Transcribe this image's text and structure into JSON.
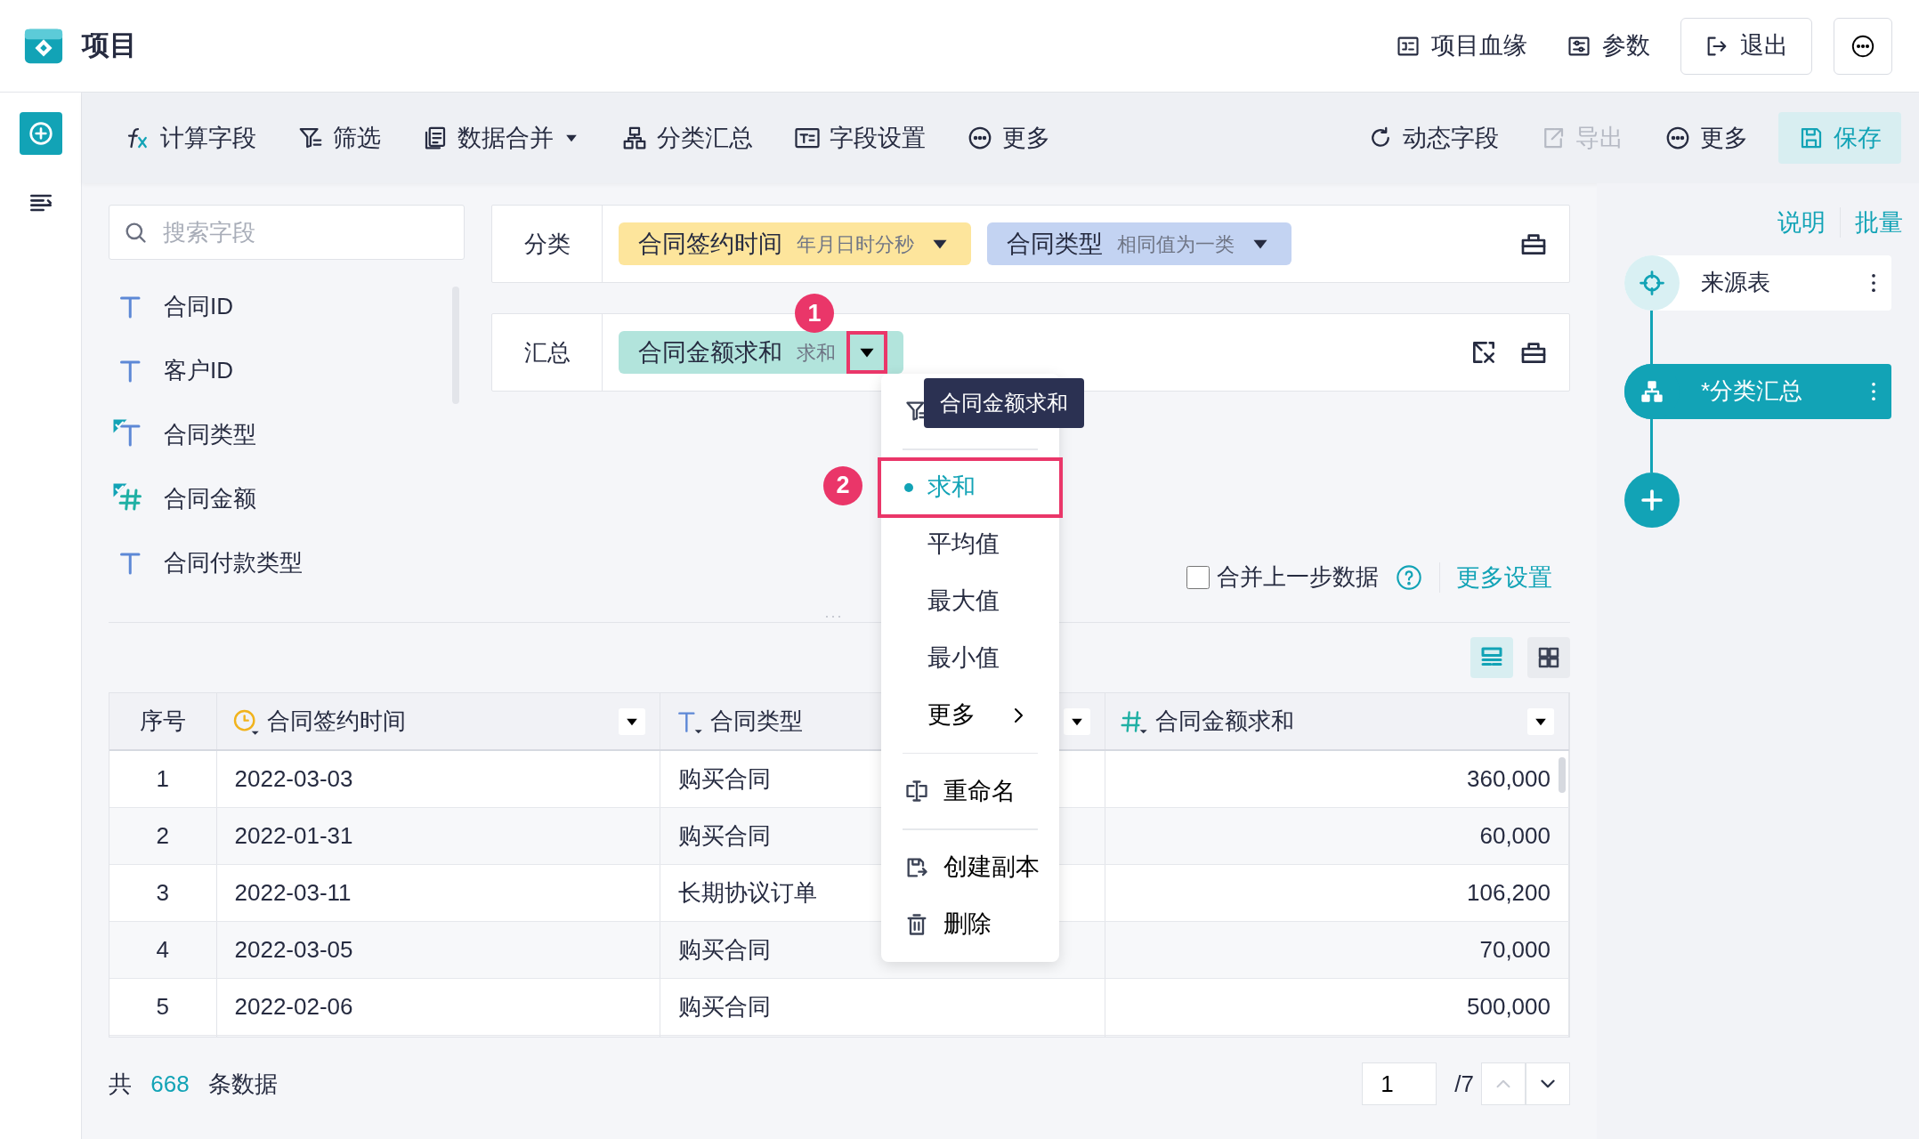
{
  "app": {
    "title": "项目"
  },
  "header_actions": [
    {
      "label": "项目血缘",
      "kind": "plain"
    },
    {
      "label": "参数",
      "kind": "plain"
    },
    {
      "label": "退出",
      "kind": "outlined"
    }
  ],
  "toolbar_left": [
    {
      "label": "计算字段",
      "has_menu": false
    },
    {
      "label": "筛选",
      "has_menu": false
    },
    {
      "label": "数据合并",
      "has_menu": true
    },
    {
      "label": "分类汇总",
      "has_menu": false
    },
    {
      "label": "字段设置",
      "has_menu": false
    },
    {
      "label": "更多",
      "has_menu": false
    }
  ],
  "toolbar_right": [
    {
      "label": "动态字段",
      "disabled": false,
      "kind": "plain"
    },
    {
      "label": "导出",
      "disabled": true,
      "kind": "plain"
    },
    {
      "label": "更多",
      "disabled": false,
      "kind": "plain"
    },
    {
      "label": "保存",
      "disabled": false,
      "kind": "primary"
    }
  ],
  "fields_panel": {
    "search": {
      "placeholder": "搜索字段"
    },
    "fields": [
      {
        "name": "合同ID",
        "kind": "text",
        "used": false
      },
      {
        "name": "客户ID",
        "kind": "text",
        "used": false
      },
      {
        "name": "合同类型",
        "kind": "text",
        "used": true
      },
      {
        "name": "合同金额",
        "kind": "number",
        "used": true
      },
      {
        "name": "合同付款类型",
        "kind": "text",
        "used": false
      }
    ]
  },
  "group_by": {
    "label": "分类",
    "chips": [
      {
        "name": "合同签约时间",
        "sub": "年月日时分秒",
        "color": "#fde59c"
      },
      {
        "name": "合同类型",
        "sub": "相同值为一类",
        "color": "#c3d3f2"
      }
    ]
  },
  "summary": {
    "label": "汇总",
    "chips": [
      {
        "name": "合同金额求和",
        "sub": "求和",
        "color": "#b2e4dc"
      }
    ]
  },
  "options": {
    "merge_checkbox": {
      "label": "合并上一步数据",
      "checked": false
    },
    "more_settings": "更多设置"
  },
  "view_modes": [
    {
      "selected": true
    },
    {
      "selected": false
    }
  ],
  "table": {
    "columns": [
      {
        "label": "序号",
        "kind": "index"
      },
      {
        "label": "合同签约时间",
        "kind": "date"
      },
      {
        "label": "合同类型",
        "kind": "text"
      },
      {
        "label": "合同金额求和",
        "kind": "number"
      }
    ],
    "rows": [
      [
        "1",
        "2022-03-03",
        "购买合同",
        "360,000"
      ],
      [
        "2",
        "2022-01-31",
        "购买合同",
        "60,000"
      ],
      [
        "3",
        "2022-03-11",
        "长期协议订单",
        "106,200"
      ],
      [
        "4",
        "2022-03-05",
        "购买合同",
        "70,000"
      ],
      [
        "5",
        "2022-02-06",
        "购买合同",
        "500,000"
      ]
    ]
  },
  "footer": {
    "total_prefix": "共",
    "total": "668",
    "total_suffix": "条数据",
    "page": "1",
    "pages": "/7"
  },
  "right_panel": {
    "links": [
      "说明",
      "批量"
    ],
    "steps": [
      {
        "label": "来源表",
        "kind": "source",
        "selected": false
      },
      {
        "label": "*分类汇总",
        "kind": "group",
        "selected": true
      }
    ]
  },
  "menu": {
    "items": [
      {
        "kind": "filter"
      },
      {
        "kind": "divider"
      },
      {
        "kind": "option",
        "label": "求和",
        "selected": true
      },
      {
        "kind": "option",
        "label": "平均值",
        "selected": false
      },
      {
        "kind": "option",
        "label": "最大值",
        "selected": false
      },
      {
        "kind": "option",
        "label": "最小值",
        "selected": false
      },
      {
        "kind": "submenu",
        "label": "更多"
      },
      {
        "kind": "divider"
      },
      {
        "kind": "rename",
        "label": "重命名"
      },
      {
        "kind": "divider"
      },
      {
        "kind": "copy",
        "label": "创建副本"
      },
      {
        "kind": "delete",
        "label": "删除"
      }
    ],
    "tooltip": "合同金额求和"
  },
  "callouts": [
    "1",
    "2"
  ]
}
